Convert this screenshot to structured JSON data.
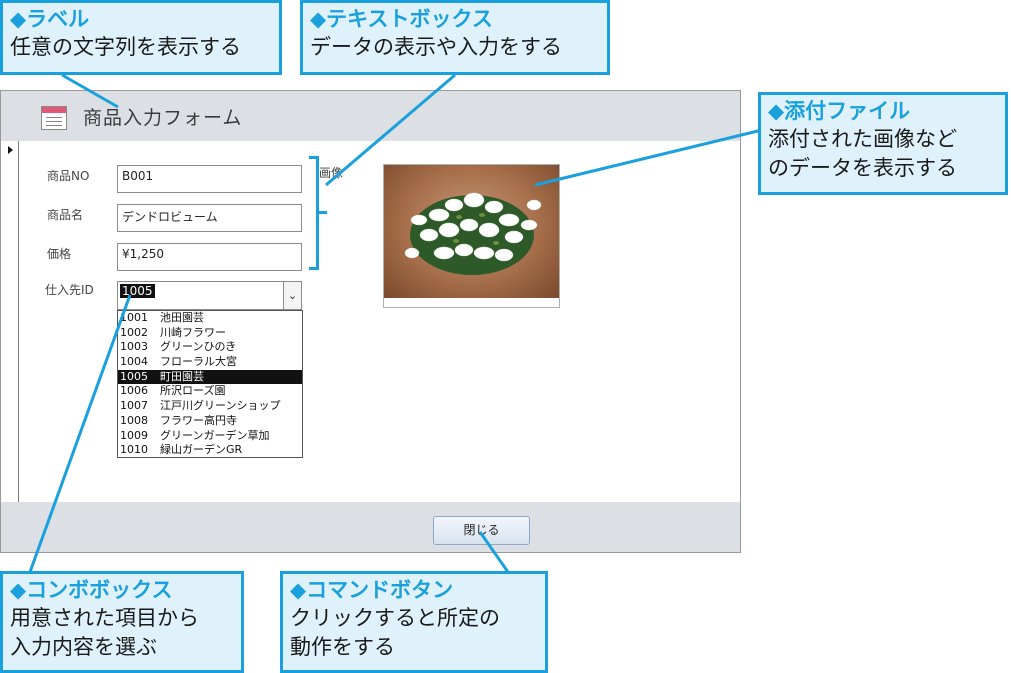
{
  "form": {
    "title": "商品入力フォーム",
    "fields": [
      {
        "label": "商品NO",
        "value": "B001"
      },
      {
        "label": "商品名",
        "value": "デンドロビューム"
      },
      {
        "label": "価格",
        "value": "¥1,250"
      }
    ],
    "supplier": {
      "label": "仕入先ID",
      "value": "1005",
      "options": [
        {
          "id": "1001",
          "name": "池田園芸"
        },
        {
          "id": "1002",
          "name": "川崎フラワー"
        },
        {
          "id": "1003",
          "name": "グリーンひのき"
        },
        {
          "id": "1004",
          "name": "フローラル大宮"
        },
        {
          "id": "1005",
          "name": "町田園芸"
        },
        {
          "id": "1006",
          "name": "所沢ローズ園"
        },
        {
          "id": "1007",
          "name": "江戸川グリーンショップ"
        },
        {
          "id": "1008",
          "name": "フラワー高円寺"
        },
        {
          "id": "1009",
          "name": "グリーンガーデン草加"
        },
        {
          "id": "1010",
          "name": "緑山ガーデンGR"
        }
      ],
      "selected_index": 4
    },
    "image_label": "画像",
    "close_label": "閉じる"
  },
  "callouts": {
    "label": {
      "title": "◆ラベル",
      "desc": "任意の文字列を表示する"
    },
    "textbox": {
      "title": "◆テキストボックス",
      "desc": "データの表示や入力をする"
    },
    "attachment": {
      "title": "◆添付ファイル",
      "desc1": "添付された画像など",
      "desc2": "のデータを表示する"
    },
    "combobox": {
      "title": "◆コンボボックス",
      "desc1": "用意された項目から",
      "desc2": "入力内容を選ぶ"
    },
    "command": {
      "title": "◆コマンドボタン",
      "desc1": "クリックすると所定の",
      "desc2": "動作をする"
    }
  },
  "colors": {
    "accent": "#1aa0dc",
    "callout_bg": "#dff1fb",
    "header_bg": "#dcdfe4"
  },
  "icons": {
    "form_icon": "form-icon",
    "record_arrow": "record-selector-arrow-icon",
    "dropdown": "chevron-down-icon"
  }
}
